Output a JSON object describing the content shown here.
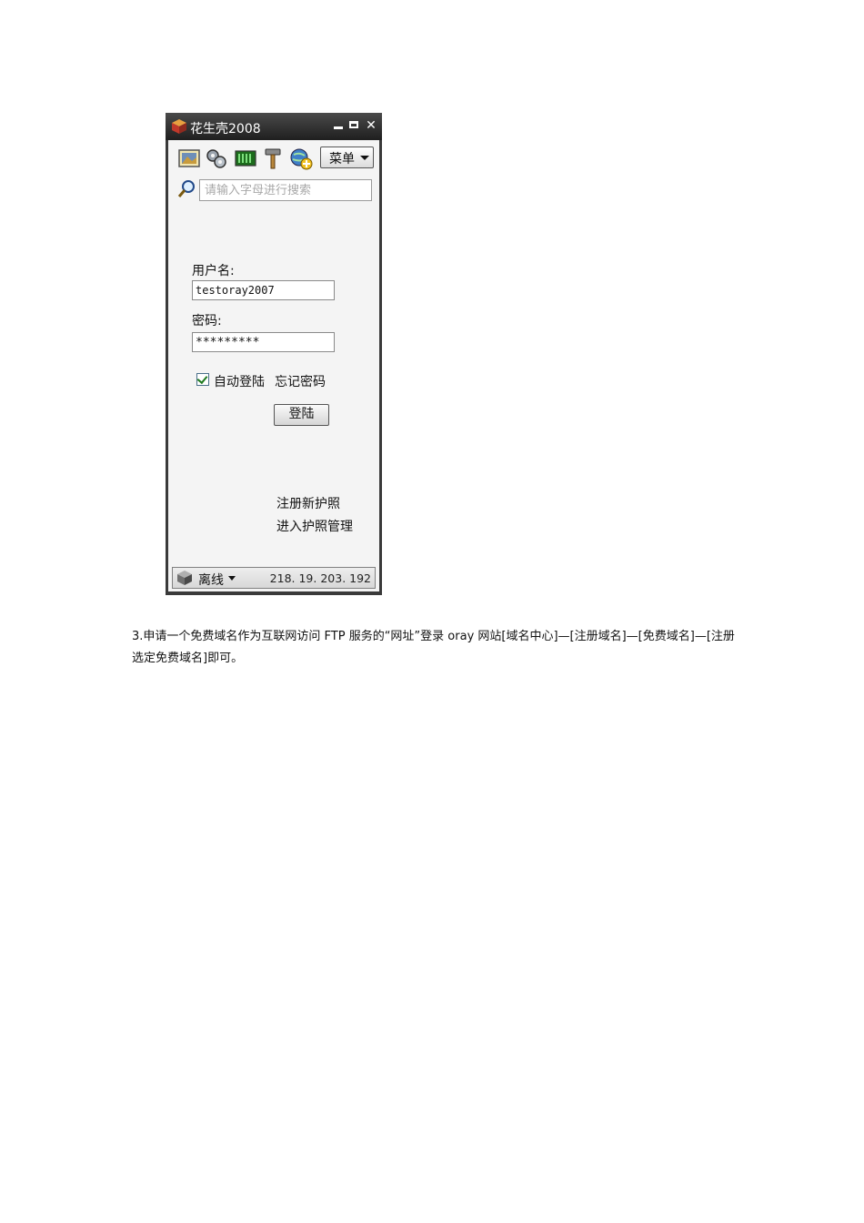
{
  "window": {
    "title": "花生壳2008",
    "close_glyph": "✕"
  },
  "toolbar": {
    "icons": [
      "image-icon",
      "settings-gears-icon",
      "memory-meter-icon",
      "hammer-icon",
      "globe-add-icon"
    ],
    "menu_label": "菜单"
  },
  "search": {
    "placeholder": "请输入字母进行搜索"
  },
  "login": {
    "username_label": "用户名:",
    "username_value": "testoray2007",
    "password_label": "密码:",
    "password_value": "*********",
    "auto_login_label": "自动登陆",
    "auto_login_checked": true,
    "forgot_password": "忘记密码",
    "login_button": "登陆"
  },
  "links": {
    "register": "注册新护照",
    "manage": "进入护照管理"
  },
  "status": {
    "state_label": "离线",
    "ip": "218. 19. 203. 192"
  },
  "document": {
    "paragraph": "3.申请一个免费域名作为互联网访问 FTP 服务的“网址”登录 oray 网站[域名中心]—[注册域名]—[免费域名]—[注册选定免费域名]即可。"
  },
  "colors": {
    "titlebar": "#2a2a2a",
    "client_bg": "#f4f4f4",
    "check_mark": "#1e7a1e"
  }
}
